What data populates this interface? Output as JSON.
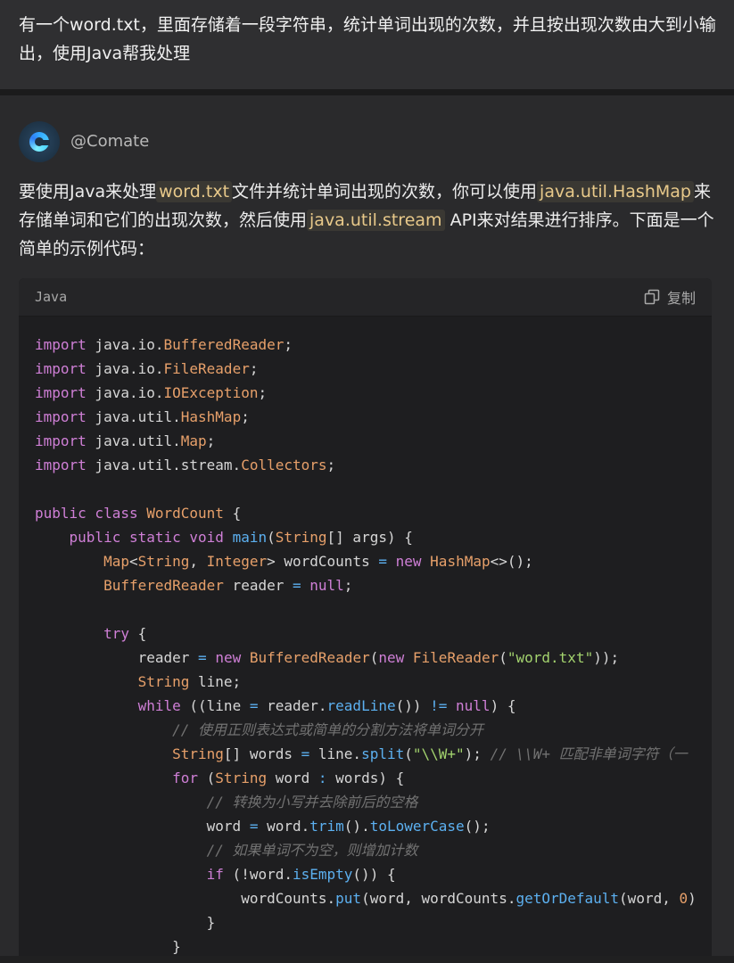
{
  "user_message": "有一个word.txt，里面存储着一段字符串，统计单词出现的次数，并且按出现次数由大到小输出，使用Java帮我处理",
  "bot": {
    "name": "@Comate",
    "avatar_icon": "comate-logo-icon"
  },
  "answer": {
    "p1": "要使用Java来处理",
    "c1": "word.txt",
    "p2": "文件并统计单词出现的次数，你可以使用",
    "c2": "java.util.HashMap",
    "p3": "来存储单词和它们的出现次数，然后使用",
    "c3": "java.util.stream",
    "p4": " API来对结果进行排序。下面是一个简单的示例代码："
  },
  "code_block": {
    "language": "Java",
    "copy_label": "复制",
    "copy_icon": "copy-icon",
    "colors": {
      "keyword": "#cf7fd6",
      "type": "#e7a06a",
      "function": "#5cb0f0",
      "string": "#a3d36e",
      "comment": "#727272"
    },
    "lines": [
      [
        [
          "kw",
          "import"
        ],
        [
          "p",
          " java.io."
        ],
        [
          "ty",
          "BufferedReader"
        ],
        [
          "p",
          ";"
        ]
      ],
      [
        [
          "kw",
          "import"
        ],
        [
          "p",
          " java.io."
        ],
        [
          "ty",
          "FileReader"
        ],
        [
          "p",
          ";"
        ]
      ],
      [
        [
          "kw",
          "import"
        ],
        [
          "p",
          " java.io."
        ],
        [
          "ty",
          "IOException"
        ],
        [
          "p",
          ";"
        ]
      ],
      [
        [
          "kw",
          "import"
        ],
        [
          "p",
          " java.util."
        ],
        [
          "ty",
          "HashMap"
        ],
        [
          "p",
          ";"
        ]
      ],
      [
        [
          "kw",
          "import"
        ],
        [
          "p",
          " java.util."
        ],
        [
          "ty",
          "Map"
        ],
        [
          "p",
          ";"
        ]
      ],
      [
        [
          "kw",
          "import"
        ],
        [
          "p",
          " java.util.stream."
        ],
        [
          "ty",
          "Collectors"
        ],
        [
          "p",
          ";"
        ]
      ],
      [],
      [
        [
          "kw",
          "public class"
        ],
        [
          "p",
          " "
        ],
        [
          "ty",
          "WordCount"
        ],
        [
          "p",
          " {"
        ]
      ],
      [
        [
          "p",
          "    "
        ],
        [
          "kw",
          "public static void"
        ],
        [
          "p",
          " "
        ],
        [
          "fn",
          "main"
        ],
        [
          "p",
          "("
        ],
        [
          "ty",
          "String"
        ],
        [
          "p",
          "[] args) {"
        ]
      ],
      [
        [
          "p",
          "        "
        ],
        [
          "ty",
          "Map"
        ],
        [
          "p",
          "<"
        ],
        [
          "ty",
          "String"
        ],
        [
          "p",
          ", "
        ],
        [
          "ty",
          "Integer"
        ],
        [
          "p",
          "> wordCounts "
        ],
        [
          "op",
          "="
        ],
        [
          "p",
          " "
        ],
        [
          "kw",
          "new"
        ],
        [
          "p",
          " "
        ],
        [
          "ty",
          "HashMap"
        ],
        [
          "p",
          "<>();"
        ]
      ],
      [
        [
          "p",
          "        "
        ],
        [
          "ty",
          "BufferedReader"
        ],
        [
          "p",
          " reader "
        ],
        [
          "op",
          "="
        ],
        [
          "p",
          " "
        ],
        [
          "kw",
          "null"
        ],
        [
          "p",
          ";"
        ]
      ],
      [],
      [
        [
          "p",
          "        "
        ],
        [
          "kw",
          "try"
        ],
        [
          "p",
          " {"
        ]
      ],
      [
        [
          "p",
          "            reader "
        ],
        [
          "op",
          "="
        ],
        [
          "p",
          " "
        ],
        [
          "kw",
          "new"
        ],
        [
          "p",
          " "
        ],
        [
          "ty",
          "BufferedReader"
        ],
        [
          "p",
          "("
        ],
        [
          "kw",
          "new"
        ],
        [
          "p",
          " "
        ],
        [
          "ty",
          "FileReader"
        ],
        [
          "p",
          "("
        ],
        [
          "st",
          "\"word.txt\""
        ],
        [
          "p",
          "));"
        ]
      ],
      [
        [
          "p",
          "            "
        ],
        [
          "ty",
          "String"
        ],
        [
          "p",
          " line;"
        ]
      ],
      [
        [
          "p",
          "            "
        ],
        [
          "kw",
          "while"
        ],
        [
          "p",
          " ((line "
        ],
        [
          "op",
          "="
        ],
        [
          "p",
          " reader."
        ],
        [
          "fn",
          "readLine"
        ],
        [
          "p",
          "()) "
        ],
        [
          "op",
          "!="
        ],
        [
          "p",
          " "
        ],
        [
          "kw",
          "null"
        ],
        [
          "p",
          ") {"
        ]
      ],
      [
        [
          "p",
          "                "
        ],
        [
          "cm",
          "// 使用正则表达式或简单的分割方法将单词分开"
        ]
      ],
      [
        [
          "p",
          "                "
        ],
        [
          "ty",
          "String"
        ],
        [
          "p",
          "[] words "
        ],
        [
          "op",
          "="
        ],
        [
          "p",
          " line."
        ],
        [
          "fn",
          "split"
        ],
        [
          "p",
          "("
        ],
        [
          "st",
          "\"\\\\W+\""
        ],
        [
          "p",
          "); "
        ],
        [
          "cm",
          "// \\\\W+ 匹配非单词字符（一"
        ]
      ],
      [
        [
          "p",
          "                "
        ],
        [
          "kw",
          "for"
        ],
        [
          "p",
          " ("
        ],
        [
          "ty",
          "String"
        ],
        [
          "p",
          " word "
        ],
        [
          "op",
          ":"
        ],
        [
          "p",
          " words) {"
        ]
      ],
      [
        [
          "p",
          "                    "
        ],
        [
          "cm",
          "// 转换为小写并去除前后的空格"
        ]
      ],
      [
        [
          "p",
          "                    word "
        ],
        [
          "op",
          "="
        ],
        [
          "p",
          " word."
        ],
        [
          "fn",
          "trim"
        ],
        [
          "p",
          "()."
        ],
        [
          "fn",
          "toLowerCase"
        ],
        [
          "p",
          "();"
        ]
      ],
      [
        [
          "p",
          "                    "
        ],
        [
          "cm",
          "// 如果单词不为空，则增加计数"
        ]
      ],
      [
        [
          "p",
          "                    "
        ],
        [
          "kw",
          "if"
        ],
        [
          "p",
          " (!word."
        ],
        [
          "fn",
          "isEmpty"
        ],
        [
          "p",
          "()) {"
        ]
      ],
      [
        [
          "p",
          "                        wordCounts."
        ],
        [
          "fn",
          "put"
        ],
        [
          "p",
          "(word, wordCounts."
        ],
        [
          "fn",
          "getOrDefault"
        ],
        [
          "p",
          "(word, "
        ],
        [
          "nu",
          "0"
        ],
        [
          "p",
          ")"
        ]
      ],
      [
        [
          "p",
          "                    }"
        ]
      ],
      [
        [
          "p",
          "                }"
        ]
      ]
    ]
  }
}
